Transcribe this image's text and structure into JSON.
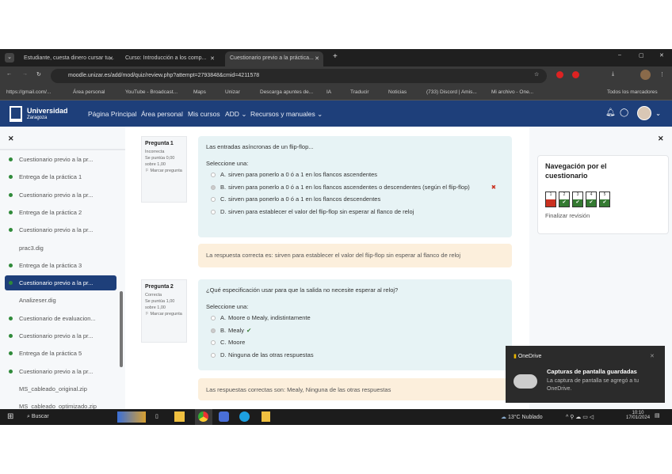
{
  "browser": {
    "tabs": [
      {
        "label": "Estudiante, cuesta dinero cursar tu..."
      },
      {
        "label": "Curso: Introducción a los comp..."
      },
      {
        "label": "Cuestionario previo a la práctica..."
      }
    ],
    "new_tab": "+",
    "url": "moodle.unizar.es/add/mod/quiz/review.php?attempt=2793848&cmid=4211578",
    "bookmarks": [
      "https://gmail.com/...",
      "Área personal",
      "YouTube - Broadcast...",
      "Maps",
      "Unizar",
      "Descarga apuntes de...",
      "IA",
      "Traducir",
      "Noticias",
      "(733) Discord | Amis...",
      "Mi archivo - One...",
      "Todos los marcadores"
    ]
  },
  "navbar": {
    "logo_title": "Universidad",
    "logo_sub": "Zaragoza",
    "links": [
      "Página Principal",
      "Área personal",
      "Mis cursos",
      "ADD",
      "Recursos y manuales"
    ]
  },
  "left_drawer": {
    "close": "✕",
    "items": [
      {
        "label": "Cuestionario previo a la pr...",
        "dot": true
      },
      {
        "label": "Entrega de la práctica 1",
        "dot": true
      },
      {
        "label": "Cuestionario previo a la pr...",
        "dot": true
      },
      {
        "label": "Entrega de la práctica 2",
        "dot": true
      },
      {
        "label": "Cuestionario previo a la pr...",
        "dot": true
      },
      {
        "label": "prac3.dig",
        "dot": false
      },
      {
        "label": "Entrega de la práctica 3",
        "dot": true
      },
      {
        "label": "Cuestionario previo a la pr...",
        "dot": true,
        "active": true
      },
      {
        "label": "Analizeser.dig",
        "dot": false
      },
      {
        "label": "Cuestionario de evaluacion...",
        "dot": true
      },
      {
        "label": "Cuestionario previo a la pr...",
        "dot": true
      },
      {
        "label": "Entrega de la práctica 5",
        "dot": true
      },
      {
        "label": "Cuestionario previo a la pr...",
        "dot": true
      },
      {
        "label": "MS_cableado_original.zip",
        "dot": false
      },
      {
        "label": "MS_cableado_optimizado.zip",
        "dot": false
      }
    ]
  },
  "questions": [
    {
      "title": "Pregunta",
      "num": "1",
      "state": "Incorrecta",
      "score": "Se puntúa 0,00 sobre 1,00",
      "flag": "Marcar pregunta",
      "text": "Las entradas asíncronas de un flip-flop...",
      "prompt": "Seleccione una:",
      "options": [
        {
          "letter": "A.",
          "text": "sirven para ponerlo a 0 ó a 1 en los flancos ascendentes"
        },
        {
          "letter": "B.",
          "text": "sirven para ponerlo a 0 ó a 1 en los flancos ascendentes o descendentes (según el flip-flop)",
          "mark": "✖"
        },
        {
          "letter": "C.",
          "text": "sirven para ponerlo a 0 ó a 1 en los flancos descendentes"
        },
        {
          "letter": "D.",
          "text": "sirven para establecer el valor del flip-flop sin esperar al flanco de reloj"
        }
      ],
      "feedback": "La respuesta correcta es: sirven para establecer el valor del flip-flop sin esperar al flanco de reloj"
    },
    {
      "title": "Pregunta",
      "num": "2",
      "state": "Correcta",
      "score": "Se puntúa 1,00 sobre 1,00",
      "flag": "Marcar pregunta",
      "text": "¿Qué especificación usar para que la salida no necesite esperar al reloj?",
      "prompt": "Seleccione una:",
      "options": [
        {
          "letter": "A.",
          "text": "Moore o Mealy, indistintamente"
        },
        {
          "letter": "B.",
          "text": "Mealy",
          "mark": "✔"
        },
        {
          "letter": "C.",
          "text": "Moore"
        },
        {
          "letter": "D.",
          "text": "Ninguna de las otras respuestas"
        }
      ],
      "feedback": "Las respuestas correctas son: Mealy, Ninguna de las otras respuestas"
    }
  ],
  "quiz_nav": {
    "close": "✕",
    "title": "Navegación por el cuestionario",
    "buttons": [
      {
        "n": "1",
        "state": "incorrect"
      },
      {
        "n": "2",
        "state": "correct"
      },
      {
        "n": "3",
        "state": "correct"
      },
      {
        "n": "4",
        "state": "correct"
      },
      {
        "n": "5",
        "state": "correct"
      }
    ],
    "finish": "Finalizar revisión"
  },
  "notification": {
    "app": "OneDrive",
    "title": "Capturas de pantalla guardadas",
    "body": "La captura de pantalla se agregó a tu OneDrive.",
    "close": "✕"
  },
  "taskbar": {
    "search": "Buscar",
    "weather": "13°C Nublado",
    "time": "10:10",
    "date": "17/01/2024"
  },
  "colors": {
    "navbar": "#1e3f7a",
    "incorrect": "#ca3120",
    "correct": "#357a32"
  }
}
